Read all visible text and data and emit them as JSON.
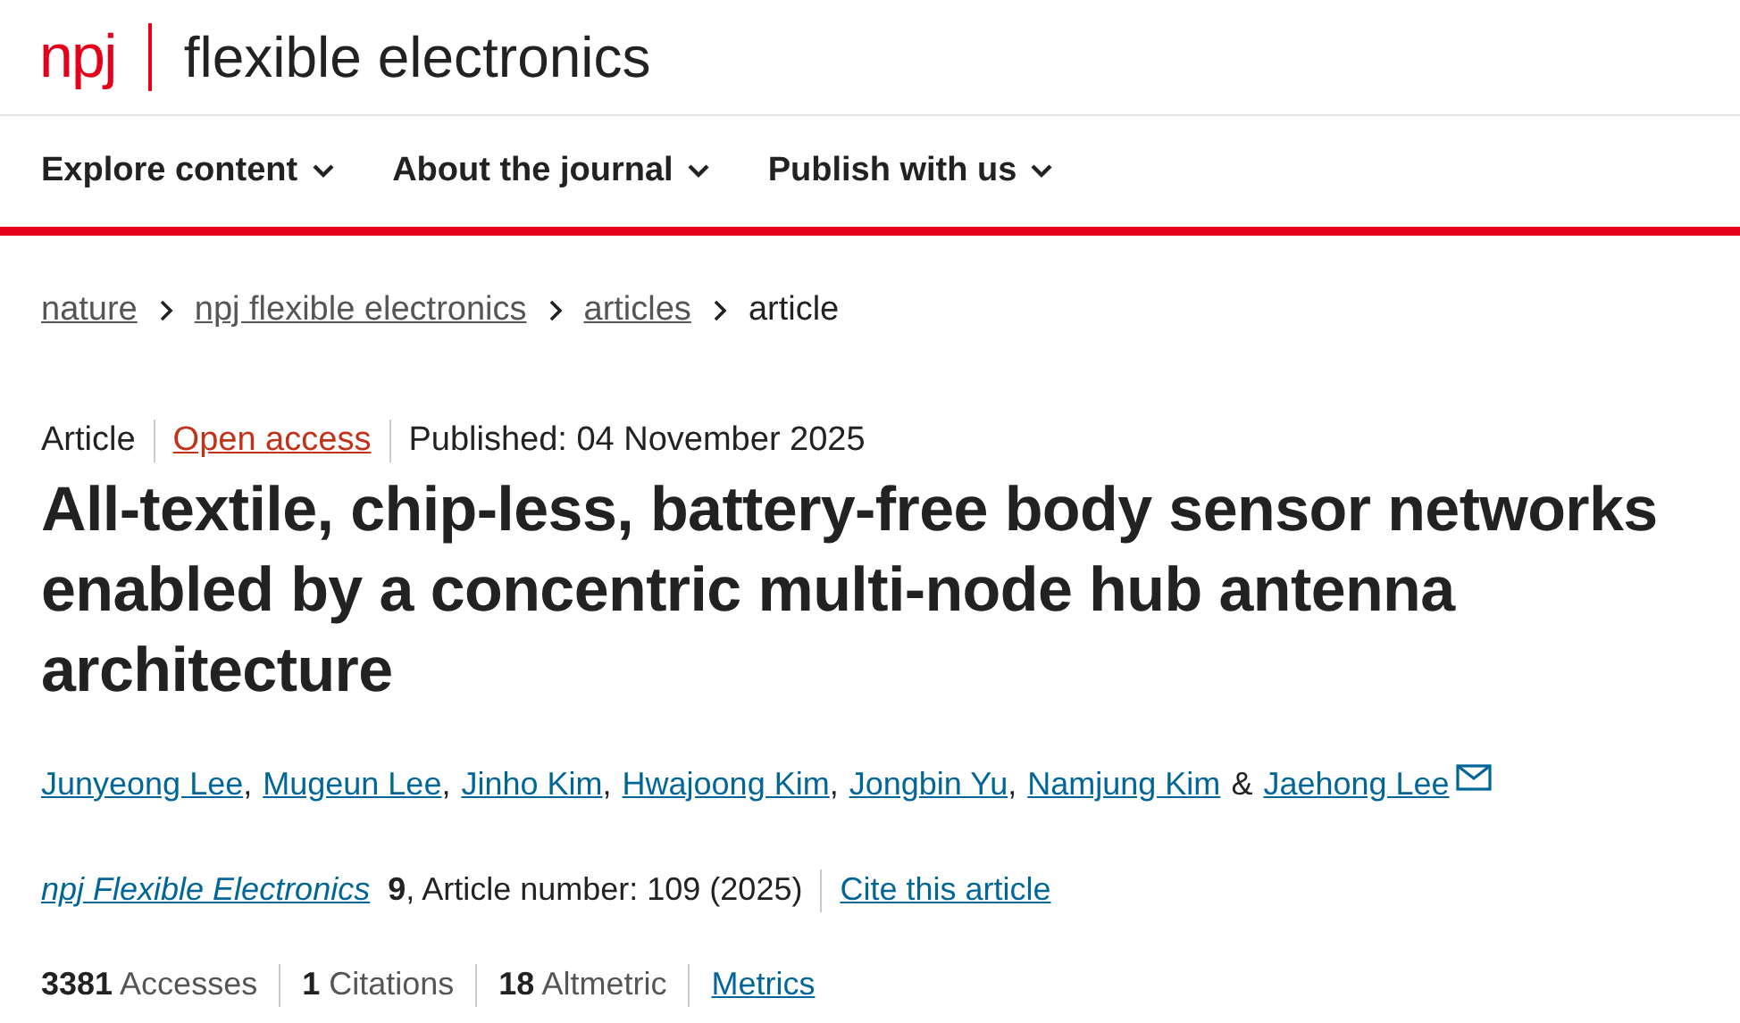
{
  "logo": {
    "mark": "npj",
    "name": "flexible electronics"
  },
  "nav": [
    {
      "label": "Explore content"
    },
    {
      "label": "About the journal"
    },
    {
      "label": "Publish with us"
    }
  ],
  "breadcrumb": [
    {
      "label": "nature",
      "link": true
    },
    {
      "label": "npj flexible electronics",
      "link": true
    },
    {
      "label": "articles",
      "link": true
    },
    {
      "label": "article",
      "link": false
    }
  ],
  "meta": {
    "type": "Article",
    "access": "Open access",
    "published": "Published: 04 November 2025"
  },
  "title": "All-textile, chip-less, battery-free body sensor networks enabled by a concentric multi-node hub antenna architecture",
  "authors": [
    {
      "name": "Junyeong Lee",
      "sep": ","
    },
    {
      "name": "Mugeun Lee",
      "sep": ","
    },
    {
      "name": "Jinho Kim",
      "sep": ","
    },
    {
      "name": "Hwajoong Kim",
      "sep": ","
    },
    {
      "name": "Jongbin Yu",
      "sep": ","
    },
    {
      "name": "Namjung Kim",
      "sep": "&"
    },
    {
      "name": "Jaehong Lee",
      "contact": true
    }
  ],
  "citation": {
    "journal": "npj Flexible Electronics",
    "volume": "9",
    "rest": ", Article number: 109 (2025)",
    "cite": "Cite this article"
  },
  "metrics": [
    {
      "kind": "stat",
      "text": "**3381** Accesses"
    },
    {
      "kind": "stat",
      "text": "**1** Citations"
    },
    {
      "kind": "stat",
      "text": "**18** Altmetric"
    },
    {
      "kind": "link",
      "text": "Metrics"
    }
  ]
}
